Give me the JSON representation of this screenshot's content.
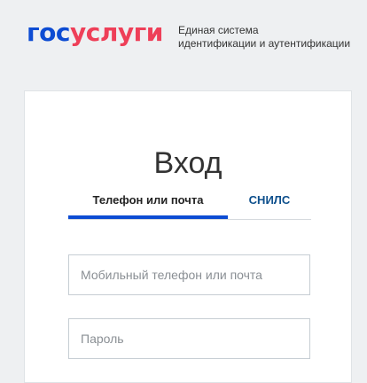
{
  "header": {
    "logo_part1": "гос",
    "logo_part2": "услуги",
    "tagline_line1": "Единая система",
    "tagline_line2": "идентификации и аутентификации"
  },
  "login": {
    "title": "Вход",
    "tabs": [
      {
        "label": "Телефон или почта",
        "active": true
      },
      {
        "label": "СНИЛС",
        "active": false
      }
    ],
    "login_field": {
      "value": "",
      "placeholder": "Мобильный телефон или почта"
    },
    "password_field": {
      "value": "",
      "placeholder": "Пароль"
    }
  },
  "colors": {
    "brand_blue": "#0d4cd3",
    "brand_red": "#ee3f58",
    "tab_link": "#0d4f8c",
    "page_background": "#eef0f2"
  }
}
